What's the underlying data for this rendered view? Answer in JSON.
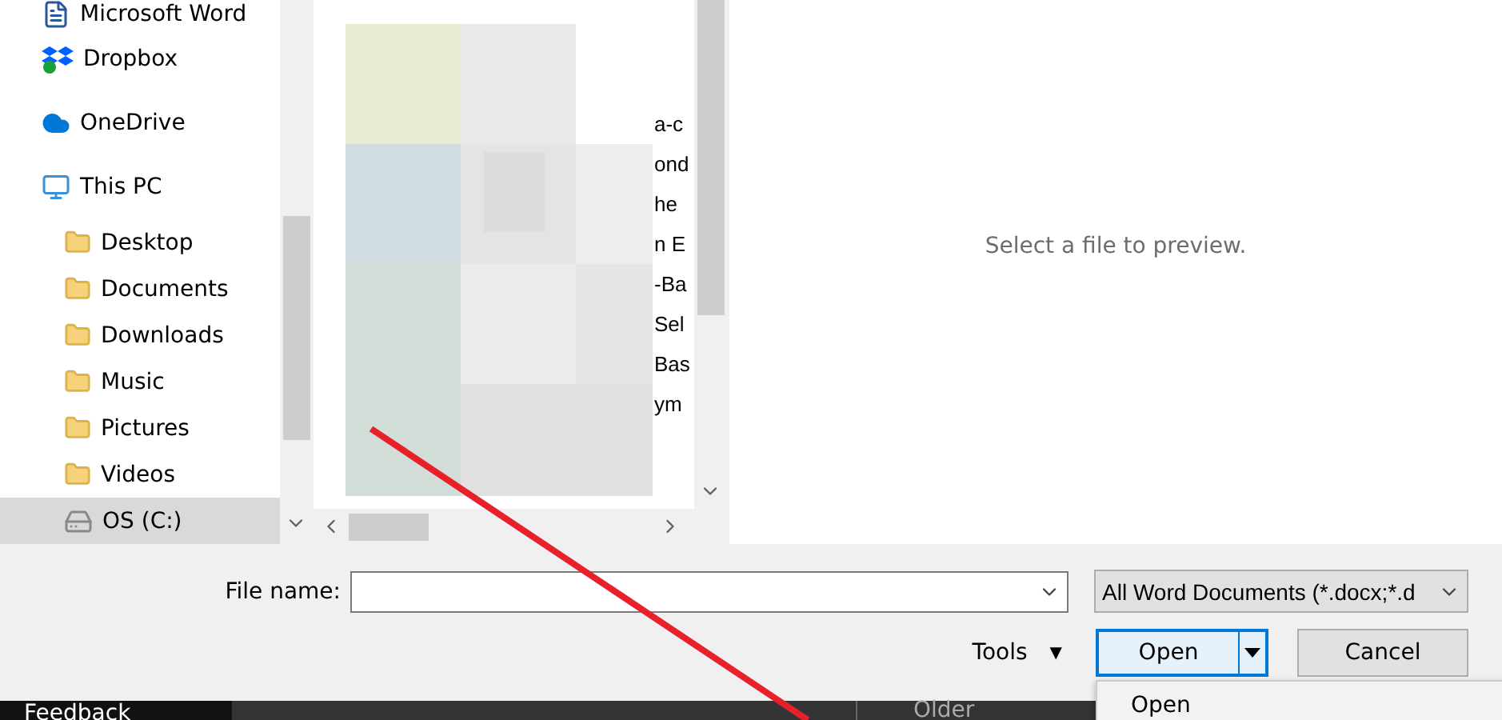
{
  "navigation": {
    "items": [
      {
        "label": "Microsoft Word",
        "selected": false
      },
      {
        "label": "Dropbox",
        "selected": false
      },
      {
        "label": "OneDrive",
        "selected": false
      },
      {
        "label": "This PC",
        "selected": false,
        "children": [
          {
            "label": "Desktop",
            "selected": false
          },
          {
            "label": "Documents",
            "selected": false
          },
          {
            "label": "Downloads",
            "selected": false
          },
          {
            "label": "Music",
            "selected": false
          },
          {
            "label": "Pictures",
            "selected": false
          },
          {
            "label": "Videos",
            "selected": false
          },
          {
            "label": "OS (C:)",
            "selected": true
          }
        ]
      }
    ]
  },
  "file_list": {
    "visible_name_fragments": [
      "a-c",
      "ond",
      "he",
      "n E",
      "-Ba",
      "Sel",
      "Bas",
      "ym"
    ]
  },
  "preview": {
    "message": "Select a file to preview."
  },
  "file_name": {
    "label": "File name:"
  },
  "file_type": {
    "value": "All Word Documents (*.docx;*.d"
  },
  "tools": {
    "label": "Tools",
    "caret": "▼"
  },
  "buttons": [
    {
      "label": "Open",
      "kind": "split",
      "focused": true
    },
    {
      "label": "Cancel",
      "kind": "plain",
      "focused": false
    }
  ],
  "open_menu": {
    "items": [
      "Open"
    ]
  },
  "background": {
    "left": "Feedback",
    "middle": "Older"
  }
}
